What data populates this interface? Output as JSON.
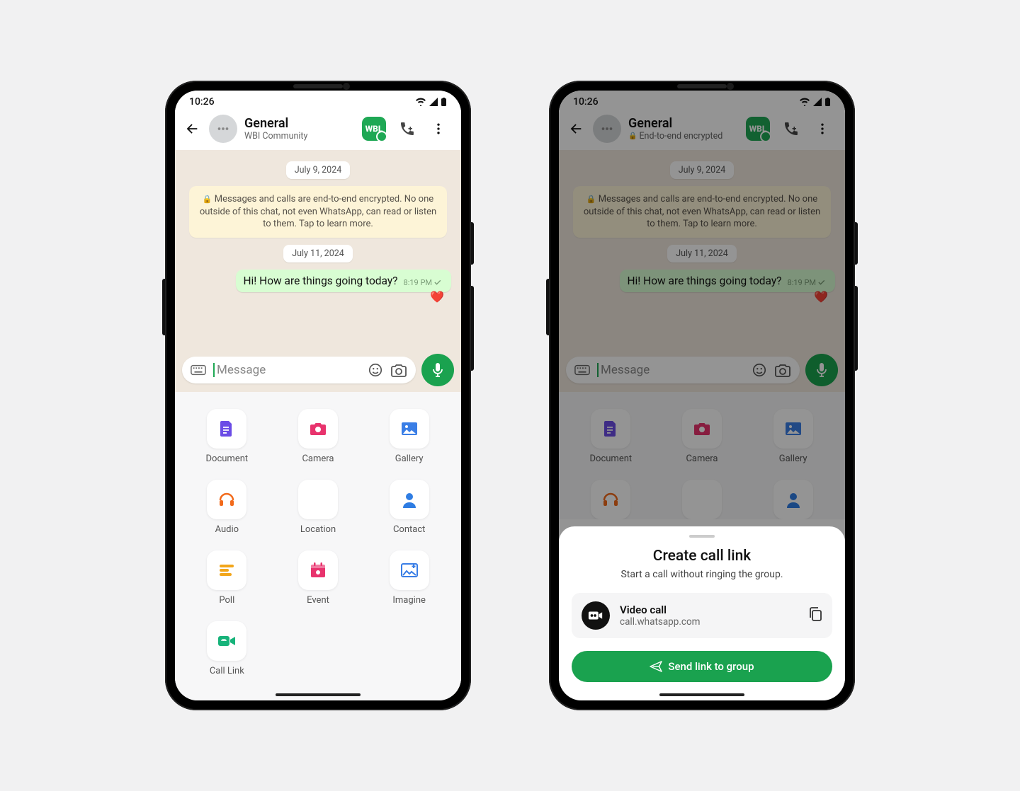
{
  "status": {
    "time": "10:26"
  },
  "chat": {
    "title": "General",
    "subtitle_a": "WBI Community",
    "subtitle_b": "End-to-end encrypted",
    "date1": "July 9, 2024",
    "notice": "Messages and calls are end-to-end encrypted. No one outside of this chat, not even WhatsApp, can read or listen to them. Tap to learn more.",
    "date2": "July 11, 2024",
    "msg": "Hi! How are things going today?",
    "msg_time": "8:19 PM",
    "input_placeholder": "Message"
  },
  "attach": {
    "items": [
      {
        "label": "Document",
        "color": "#6b4ce6"
      },
      {
        "label": "Camera",
        "color": "#e8336d"
      },
      {
        "label": "Gallery",
        "color": "#3a7ee6"
      },
      {
        "label": "Audio",
        "color": "#f26a1b"
      },
      {
        "label": "Location",
        "color": "#17b37a"
      },
      {
        "label": "Contact",
        "color": "#2f7de3"
      },
      {
        "label": "Poll",
        "color": "#f2a61b"
      },
      {
        "label": "Event",
        "color": "#e8336d"
      },
      {
        "label": "Imagine",
        "color": "#3a7ee6"
      },
      {
        "label": "Call Link",
        "color": "#17b37a"
      }
    ]
  },
  "sheet": {
    "title": "Create call link",
    "subtitle": "Start a call without ringing the group.",
    "link_title": "Video call",
    "link_url": "call.whatsapp.com",
    "button": "Send link to group"
  }
}
